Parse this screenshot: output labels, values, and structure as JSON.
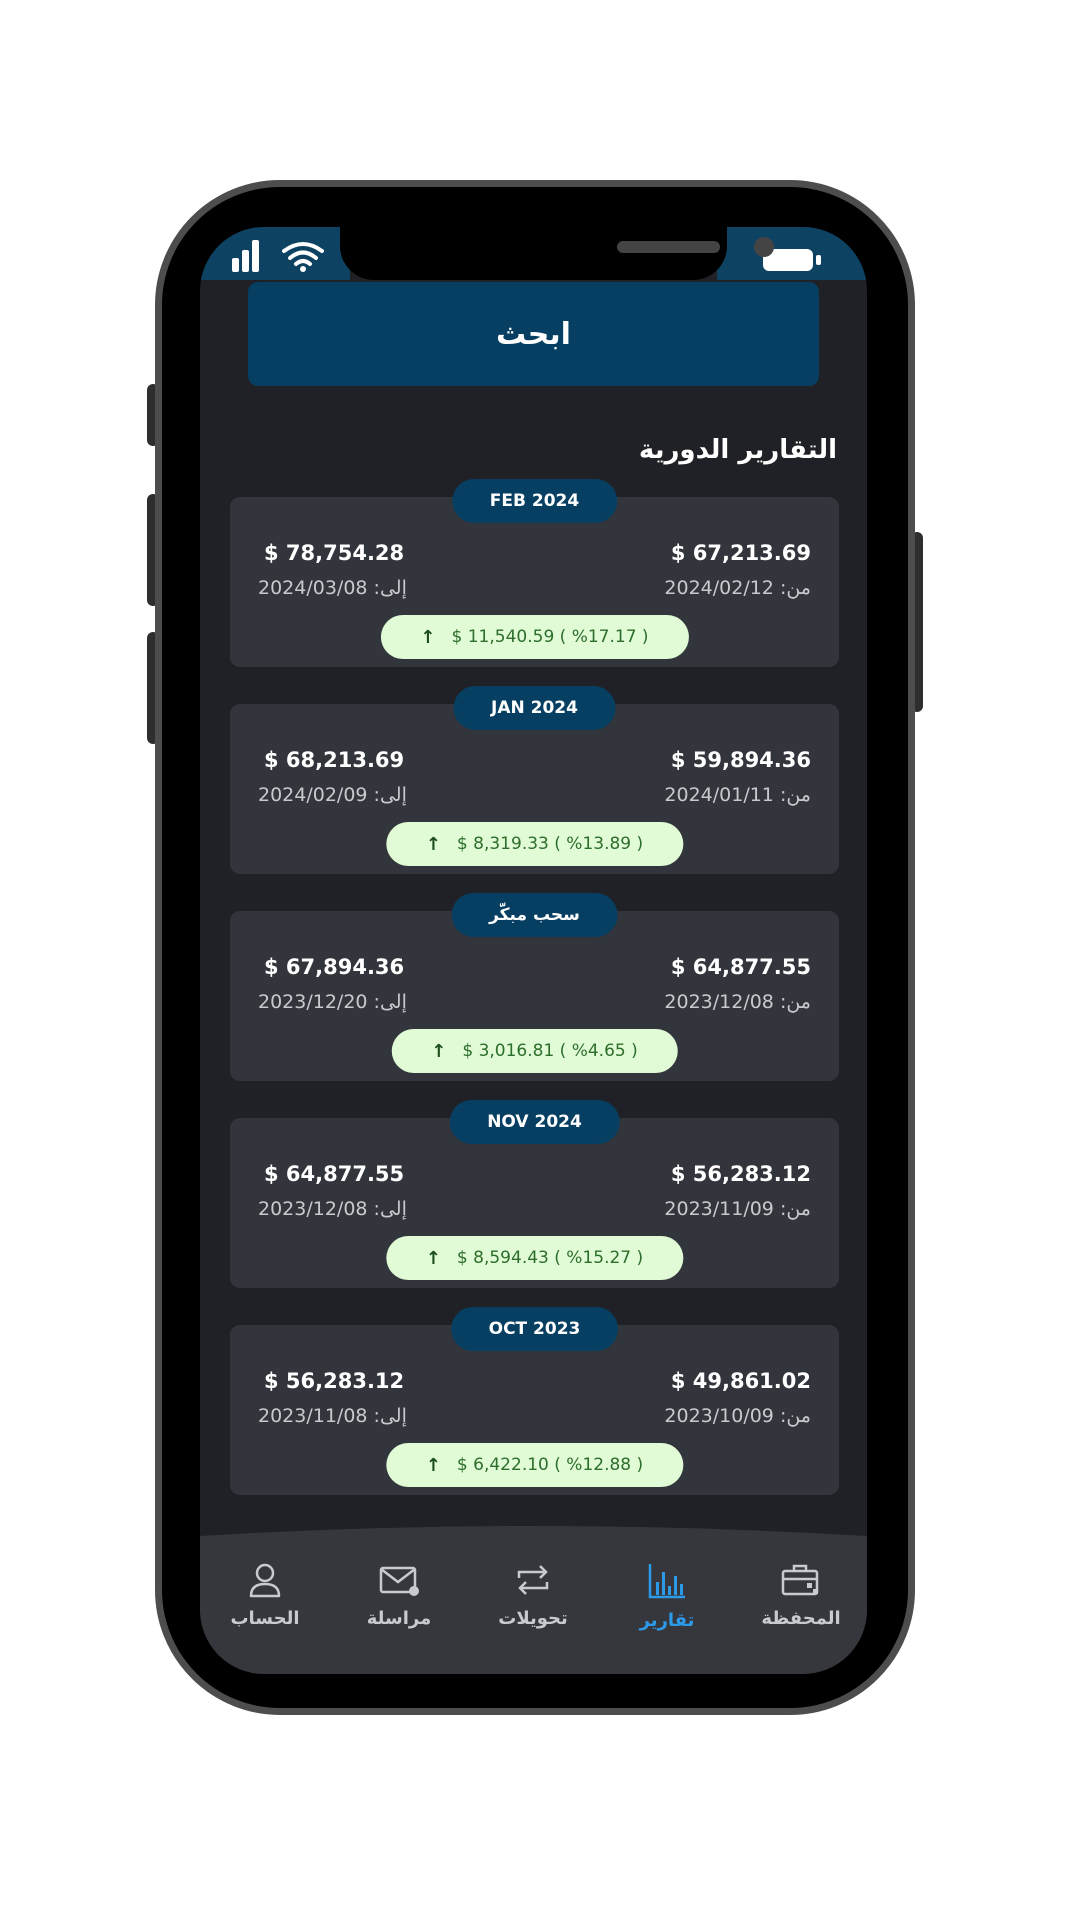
{
  "search": {
    "label": "ابحث"
  },
  "section": {
    "title": "التقارير الدورية"
  },
  "cards": [
    {
      "tag": "FEB 2024",
      "from_amount": "$ 67,213.69",
      "to_amount": "$ 78,754.28",
      "from_date": "من: 2024/02/12",
      "to_date": "إلى: 2024/03/08",
      "change": "$ 11,540.59 ( %17.17 )"
    },
    {
      "tag": "JAN 2024",
      "from_amount": "$ 59,894.36",
      "to_amount": "$ 68,213.69",
      "from_date": "من: 2024/01/11",
      "to_date": "إلى: 2024/02/09",
      "change": "$ 8,319.33 ( %13.89 )"
    },
    {
      "tag": "سحب مبكّر",
      "from_amount": "$ 64,877.55",
      "to_amount": "$ 67,894.36",
      "from_date": "من: 2023/12/08",
      "to_date": "إلى: 2023/12/20",
      "change": "$ 3,016.81 ( %4.65 )"
    },
    {
      "tag": "NOV 2024",
      "from_amount": "$ 56,283.12",
      "to_amount": "$ 64,877.55",
      "from_date": "من: 2023/11/09",
      "to_date": "إلى: 2023/12/08",
      "change": "$ 8,594.43 ( %15.27 )"
    },
    {
      "tag": "OCT 2023",
      "from_amount": "$ 49,861.02",
      "to_amount": "$ 56,283.12",
      "from_date": "من: 2023/10/09",
      "to_date": "إلى: 2023/11/08",
      "change": "$ 6,422.10 ( %12.88 )"
    }
  ],
  "nav": {
    "account": "الحساب",
    "messages": "مراسلة",
    "transfers": "تحويلات",
    "reports": "تقارير",
    "wallet": "المحفظة",
    "active_color": "#2c9ae8"
  }
}
